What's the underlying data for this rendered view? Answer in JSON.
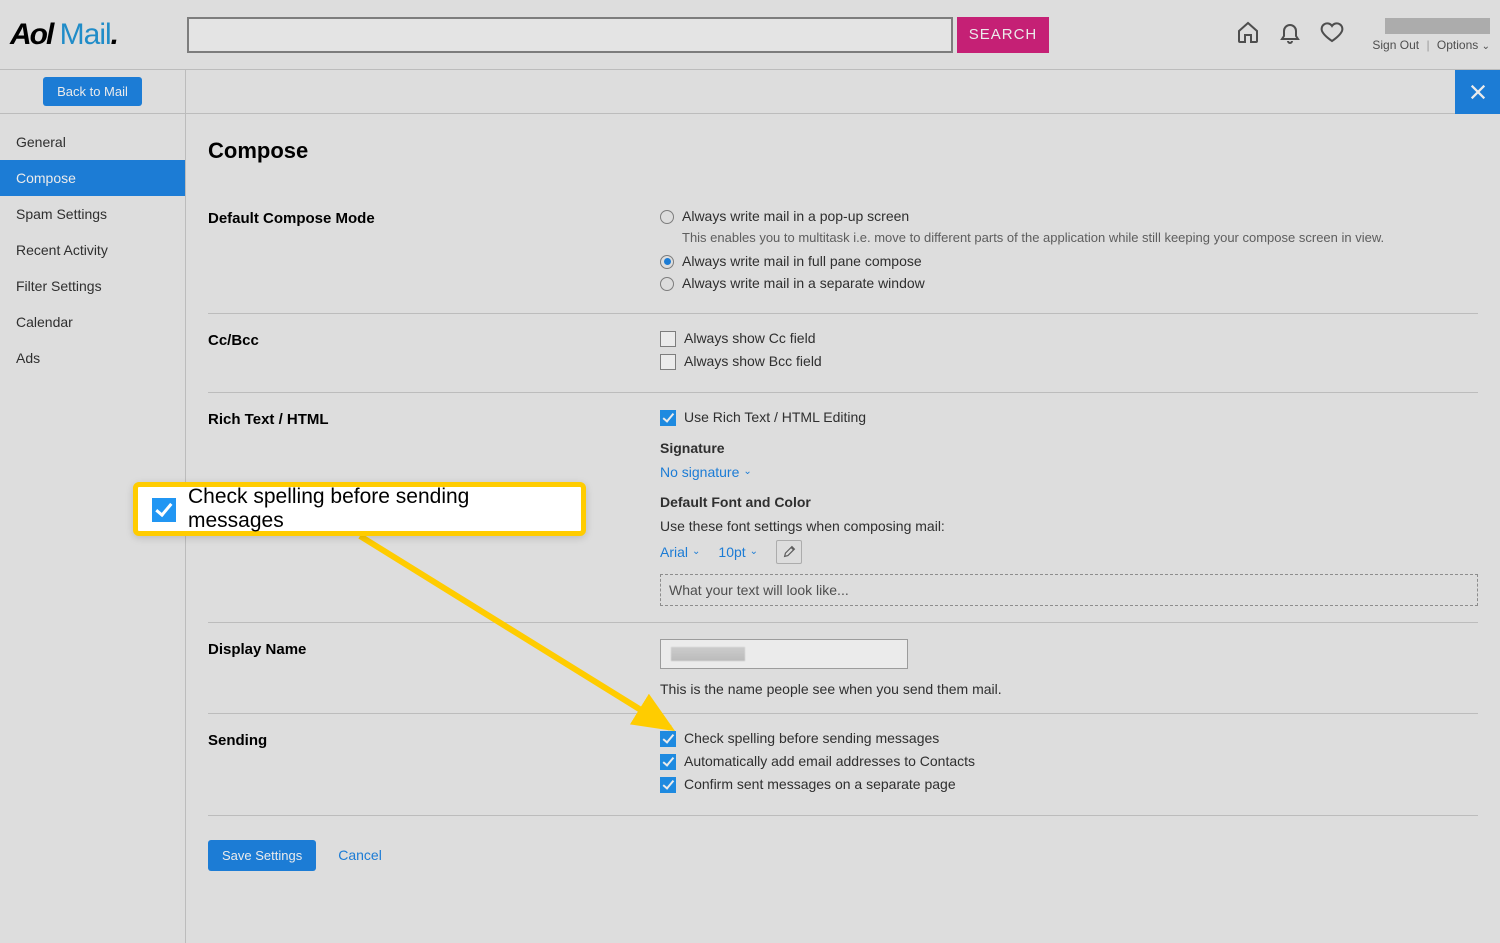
{
  "header": {
    "logo_aol": "Aol",
    "logo_mail": " Mail",
    "logo_dot": ".",
    "search_placeholder": "",
    "search_button": "SEARCH",
    "sign_out": "Sign Out",
    "options": "Options"
  },
  "topbar": {
    "back_to_mail": "Back to Mail"
  },
  "sidebar": {
    "items": [
      {
        "label": "General"
      },
      {
        "label": "Compose"
      },
      {
        "label": "Spam Settings"
      },
      {
        "label": "Recent Activity"
      },
      {
        "label": "Filter Settings"
      },
      {
        "label": "Calendar"
      },
      {
        "label": "Ads"
      }
    ]
  },
  "page": {
    "title": "Compose"
  },
  "compose_mode": {
    "label": "Default Compose Mode",
    "opt_popup": "Always write mail in a pop-up screen",
    "opt_popup_desc": "This enables you to multitask i.e. move to different parts of the application while still keeping your compose screen in view.",
    "opt_fullpane": "Always write mail in full pane compose",
    "opt_separate": "Always write mail in a separate window"
  },
  "ccbcc": {
    "label": "Cc/Bcc",
    "show_cc": "Always show Cc field",
    "show_bcc": "Always show Bcc field"
  },
  "richtext": {
    "label": "Rich Text / HTML",
    "use_rich": "Use Rich Text / HTML Editing",
    "signature_heading": "Signature",
    "signature_value": "No signature",
    "font_heading": "Default Font and Color",
    "font_desc": "Use these font settings when composing mail:",
    "font_name": "Arial",
    "font_size": "10pt",
    "preview": "What your text will look like..."
  },
  "display_name": {
    "label": "Display Name",
    "help": "This is the name people see when you send them mail."
  },
  "sending": {
    "label": "Sending",
    "check_spelling": "Check spelling before sending messages",
    "auto_contacts": "Automatically add email addresses to Contacts",
    "confirm_sent": "Confirm sent messages on a separate page"
  },
  "footer": {
    "save": "Save Settings",
    "cancel": "Cancel"
  },
  "callout": {
    "text": "Check spelling before sending messages"
  }
}
